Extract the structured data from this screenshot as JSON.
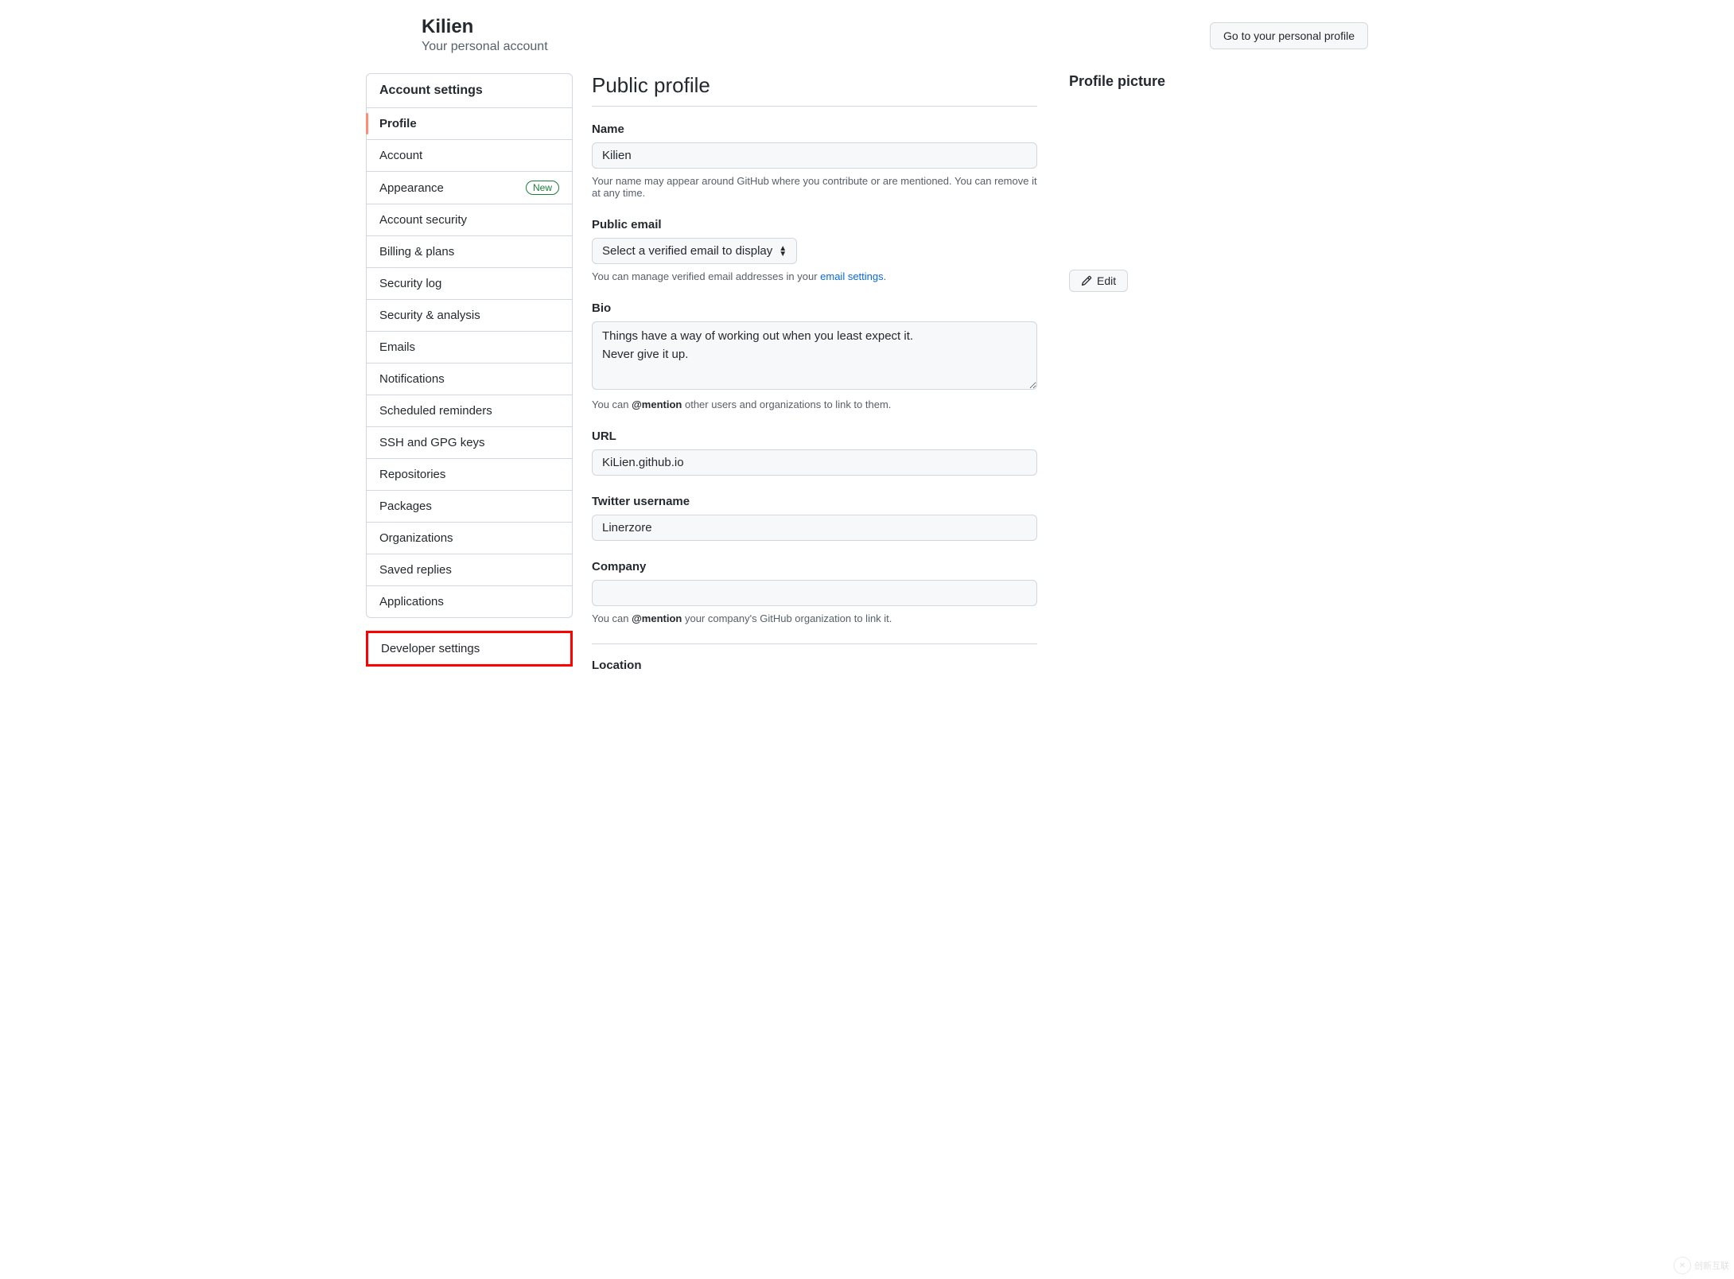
{
  "header": {
    "user_name": "Kilien",
    "subtitle": "Your personal account",
    "goto_button": "Go to your personal profile"
  },
  "sidebar": {
    "group1_header": "Account settings",
    "items": [
      {
        "label": "Profile",
        "active": true
      },
      {
        "label": "Account"
      },
      {
        "label": "Appearance",
        "badge": "New"
      },
      {
        "label": "Account security"
      },
      {
        "label": "Billing & plans"
      },
      {
        "label": "Security log"
      },
      {
        "label": "Security & analysis"
      },
      {
        "label": "Emails"
      },
      {
        "label": "Notifications"
      },
      {
        "label": "Scheduled reminders"
      },
      {
        "label": "SSH and GPG keys"
      },
      {
        "label": "Repositories"
      },
      {
        "label": "Packages"
      },
      {
        "label": "Organizations"
      },
      {
        "label": "Saved replies"
      },
      {
        "label": "Applications"
      }
    ],
    "developer_label": "Developer settings"
  },
  "profile": {
    "page_title": "Public profile",
    "name_label": "Name",
    "name_value": "Kilien",
    "name_helper": "Your name may appear around GitHub where you contribute or are mentioned. You can remove it at any time.",
    "email_label": "Public email",
    "email_selected": "Select a verified email to display",
    "email_helper_pre": "You can manage verified email addresses in your ",
    "email_helper_link": "email settings",
    "email_helper_post": ".",
    "bio_label": "Bio",
    "bio_value": "Things have a way of working out when you least expect it.\nNever give it up.",
    "bio_helper_pre": "You can ",
    "bio_helper_strong": "@mention",
    "bio_helper_post": " other users and organizations to link to them.",
    "url_label": "URL",
    "url_value": "KiLien.github.io",
    "twitter_label": "Twitter username",
    "twitter_value": "Linerzore",
    "company_label": "Company",
    "company_value": "",
    "company_helper_pre": "You can ",
    "company_helper_strong": "@mention",
    "company_helper_post": " your company's GitHub organization to link it.",
    "location_label": "Location"
  },
  "picture": {
    "section_title": "Profile picture",
    "edit_label": "Edit"
  },
  "watermark": "创新互联"
}
